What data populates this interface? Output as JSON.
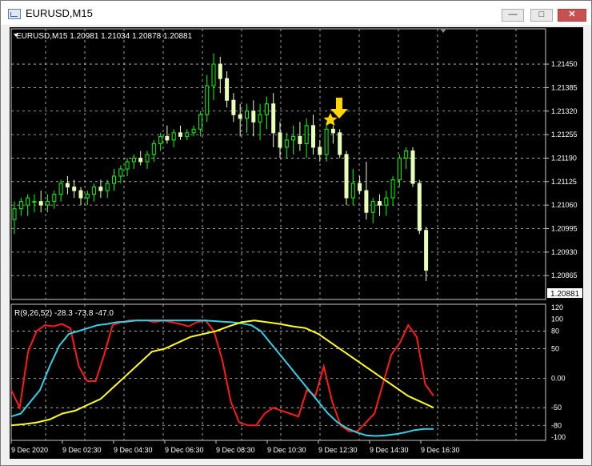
{
  "window": {
    "title": "EURUSD,M15",
    "minimize_icon": "minimize-icon",
    "maximize_icon": "maximize-icon",
    "close_icon": "close-icon"
  },
  "chart": {
    "header": "EURUSD,M15  1.20981 1.21034 1.20878 1.20881",
    "current_price": "1.20881",
    "price_labels": [
      "1.21450",
      "1.21385",
      "1.21320",
      "1.21255",
      "1.21190",
      "1.21125",
      "1.21060",
      "1.20995",
      "1.20930",
      "1.20865"
    ],
    "indicator_header": "R(9,26,52) -28.3 -73.8 -47.0",
    "indicator_labels": [
      "120",
      "100",
      "80",
      "50",
      "0.00",
      "-50",
      "-80",
      "-100"
    ],
    "time_labels": [
      "9 Dec 2020",
      "9 Dec 02:30",
      "9 Dec 04:30",
      "9 Dec 06:30",
      "9 Dec 08:30",
      "9 Dec 10:30",
      "9 Dec 12:30",
      "9 Dec 14:30",
      "9 Dec 16:30"
    ],
    "arrow_icon": "down-arrow-icon",
    "star_icon": "star-icon",
    "colors": {
      "background": "#000000",
      "grid": "#c8c8c8",
      "bull": "#00ff00",
      "bear": "#e8ffb8",
      "fast": "#ff1a1a",
      "mid": "#32d2e6",
      "slow": "#ffff20",
      "marker": "#ffd500"
    }
  },
  "chart_data": {
    "type": "candlestick",
    "symbol": "EURUSD",
    "timeframe": "M15",
    "ylim": [
      1.2083,
      1.2149
    ],
    "candles": [
      {
        "o": 1.2102,
        "h": 1.2107,
        "l": 1.2098,
        "c": 1.2105
      },
      {
        "o": 1.2105,
        "h": 1.2108,
        "l": 1.2103,
        "c": 1.2107
      },
      {
        "o": 1.2106,
        "h": 1.2109,
        "l": 1.2103,
        "c": 1.2108
      },
      {
        "o": 1.2107,
        "h": 1.2109,
        "l": 1.2104,
        "c": 1.2107
      },
      {
        "o": 1.2107,
        "h": 1.211,
        "l": 1.2104,
        "c": 1.2106
      },
      {
        "o": 1.2106,
        "h": 1.2109,
        "l": 1.2104,
        "c": 1.2107
      },
      {
        "o": 1.2107,
        "h": 1.211,
        "l": 1.2105,
        "c": 1.2109
      },
      {
        "o": 1.2109,
        "h": 1.2113,
        "l": 1.2107,
        "c": 1.2112
      },
      {
        "o": 1.2112,
        "h": 1.2114,
        "l": 1.2109,
        "c": 1.2111
      },
      {
        "o": 1.2111,
        "h": 1.2113,
        "l": 1.2108,
        "c": 1.211
      },
      {
        "o": 1.211,
        "h": 1.2111,
        "l": 1.2106,
        "c": 1.2108
      },
      {
        "o": 1.2108,
        "h": 1.211,
        "l": 1.2106,
        "c": 1.2109
      },
      {
        "o": 1.2109,
        "h": 1.2112,
        "l": 1.2107,
        "c": 1.2111
      },
      {
        "o": 1.2111,
        "h": 1.2113,
        "l": 1.2108,
        "c": 1.211
      },
      {
        "o": 1.211,
        "h": 1.2113,
        "l": 1.2108,
        "c": 1.2112
      },
      {
        "o": 1.2112,
        "h": 1.2116,
        "l": 1.211,
        "c": 1.2114
      },
      {
        "o": 1.2114,
        "h": 1.2117,
        "l": 1.2112,
        "c": 1.2116
      },
      {
        "o": 1.2116,
        "h": 1.2119,
        "l": 1.2114,
        "c": 1.2118
      },
      {
        "o": 1.2118,
        "h": 1.212,
        "l": 1.2116,
        "c": 1.2119
      },
      {
        "o": 1.2119,
        "h": 1.2121,
        "l": 1.2117,
        "c": 1.2118
      },
      {
        "o": 1.2118,
        "h": 1.2121,
        "l": 1.2116,
        "c": 1.212
      },
      {
        "o": 1.212,
        "h": 1.2124,
        "l": 1.2118,
        "c": 1.2123
      },
      {
        "o": 1.2123,
        "h": 1.2126,
        "l": 1.2121,
        "c": 1.2125
      },
      {
        "o": 1.2125,
        "h": 1.2128,
        "l": 1.2123,
        "c": 1.2124
      },
      {
        "o": 1.2124,
        "h": 1.2127,
        "l": 1.2122,
        "c": 1.2126
      },
      {
        "o": 1.2126,
        "h": 1.2128,
        "l": 1.2124,
        "c": 1.2125
      },
      {
        "o": 1.2125,
        "h": 1.2127,
        "l": 1.2124,
        "c": 1.2126
      },
      {
        "o": 1.2126,
        "h": 1.2128,
        "l": 1.2125,
        "c": 1.2127
      },
      {
        "o": 1.2127,
        "h": 1.2132,
        "l": 1.2125,
        "c": 1.2131
      },
      {
        "o": 1.2131,
        "h": 1.2142,
        "l": 1.2129,
        "c": 1.2139
      },
      {
        "o": 1.2139,
        "h": 1.2148,
        "l": 1.2135,
        "c": 1.2145
      },
      {
        "o": 1.2145,
        "h": 1.2147,
        "l": 1.2137,
        "c": 1.2141
      },
      {
        "o": 1.2141,
        "h": 1.2143,
        "l": 1.2133,
        "c": 1.2135
      },
      {
        "o": 1.2135,
        "h": 1.2137,
        "l": 1.2129,
        "c": 1.2131
      },
      {
        "o": 1.2131,
        "h": 1.2134,
        "l": 1.2125,
        "c": 1.213
      },
      {
        "o": 1.213,
        "h": 1.2134,
        "l": 1.2126,
        "c": 1.2132
      },
      {
        "o": 1.2132,
        "h": 1.2135,
        "l": 1.2125,
        "c": 1.2129
      },
      {
        "o": 1.2129,
        "h": 1.2134,
        "l": 1.2124,
        "c": 1.2131
      },
      {
        "o": 1.2131,
        "h": 1.2136,
        "l": 1.2127,
        "c": 1.2134
      },
      {
        "o": 1.2134,
        "h": 1.2137,
        "l": 1.2122,
        "c": 1.2126
      },
      {
        "o": 1.2126,
        "h": 1.2129,
        "l": 1.2119,
        "c": 1.2122
      },
      {
        "o": 1.2122,
        "h": 1.2126,
        "l": 1.2119,
        "c": 1.2124
      },
      {
        "o": 1.2124,
        "h": 1.2128,
        "l": 1.212,
        "c": 1.2125
      },
      {
        "o": 1.2125,
        "h": 1.2129,
        "l": 1.2121,
        "c": 1.2123
      },
      {
        "o": 1.2123,
        "h": 1.213,
        "l": 1.2119,
        "c": 1.2128
      },
      {
        "o": 1.2128,
        "h": 1.2131,
        "l": 1.212,
        "c": 1.2122
      },
      {
        "o": 1.2122,
        "h": 1.2124,
        "l": 1.2118,
        "c": 1.212
      },
      {
        "o": 1.212,
        "h": 1.2129,
        "l": 1.2118,
        "c": 1.2127
      },
      {
        "o": 1.2127,
        "h": 1.2128,
        "l": 1.2123,
        "c": 1.2126
      },
      {
        "o": 1.2126,
        "h": 1.2127,
        "l": 1.2119,
        "c": 1.212
      },
      {
        "o": 1.212,
        "h": 1.2121,
        "l": 1.2106,
        "c": 1.2108
      },
      {
        "o": 1.2108,
        "h": 1.2116,
        "l": 1.2106,
        "c": 1.2112
      },
      {
        "o": 1.2112,
        "h": 1.2114,
        "l": 1.2109,
        "c": 1.211
      },
      {
        "o": 1.211,
        "h": 1.2118,
        "l": 1.2102,
        "c": 1.2104
      },
      {
        "o": 1.2104,
        "h": 1.2108,
        "l": 1.2101,
        "c": 1.2107
      },
      {
        "o": 1.2107,
        "h": 1.2109,
        "l": 1.2103,
        "c": 1.2106
      },
      {
        "o": 1.2106,
        "h": 1.211,
        "l": 1.2103,
        "c": 1.2108
      },
      {
        "o": 1.2108,
        "h": 1.2114,
        "l": 1.2106,
        "c": 1.2113
      },
      {
        "o": 1.2113,
        "h": 1.212,
        "l": 1.2111,
        "c": 1.2119
      },
      {
        "o": 1.2119,
        "h": 1.2122,
        "l": 1.2116,
        "c": 1.2121
      },
      {
        "o": 1.2121,
        "h": 1.2122,
        "l": 1.2111,
        "c": 1.2112
      },
      {
        "o": 1.2112,
        "h": 1.2113,
        "l": 1.2098,
        "c": 1.2099
      },
      {
        "o": 1.2099,
        "h": 1.21,
        "l": 1.2085,
        "c": 1.2088
      }
    ],
    "indicator": {
      "name": "R(9,26,52)",
      "values": [
        -28.3,
        -73.8,
        -47.0
      ],
      "ylim": [
        -100,
        120
      ],
      "levels": [
        120,
        100,
        80,
        50,
        0,
        -50,
        -80,
        -100
      ],
      "series": [
        {
          "name": "9",
          "color": "#ff1a1a",
          "values": [
            -20,
            -50,
            45,
            80,
            90,
            88,
            92,
            85,
            20,
            -5,
            -5,
            40,
            90,
            95,
            98,
            98,
            98,
            95,
            98,
            95,
            92,
            88,
            95,
            98,
            80,
            30,
            -40,
            -75,
            -80,
            -80,
            -60,
            -50,
            -55,
            -60,
            -65,
            -20,
            -30,
            20,
            -40,
            -80,
            -90,
            -90,
            -75,
            -60,
            -10,
            40,
            60,
            90,
            70,
            -10,
            -30
          ]
        },
        {
          "name": "26",
          "color": "#32d2e6",
          "values": [
            -65,
            -60,
            -40,
            -20,
            20,
            55,
            75,
            80,
            85,
            90,
            92,
            95,
            96,
            98,
            98,
            98,
            98,
            98,
            98,
            98,
            98,
            97,
            96,
            95,
            93,
            90,
            80,
            60,
            40,
            20,
            0,
            -20,
            -40,
            -60,
            -75,
            -85,
            -92,
            -97,
            -98,
            -97,
            -95,
            -92,
            -88,
            -86,
            -86
          ]
        },
        {
          "name": "52",
          "color": "#ffff20",
          "values": [
            -80,
            -78,
            -75,
            -70,
            -60,
            -55,
            -45,
            -35,
            -15,
            5,
            25,
            45,
            50,
            60,
            70,
            75,
            80,
            88,
            95,
            98,
            95,
            92,
            88,
            85,
            75,
            60,
            45,
            30,
            15,
            0,
            -15,
            -30,
            -40,
            -50
          ]
        }
      ]
    }
  }
}
